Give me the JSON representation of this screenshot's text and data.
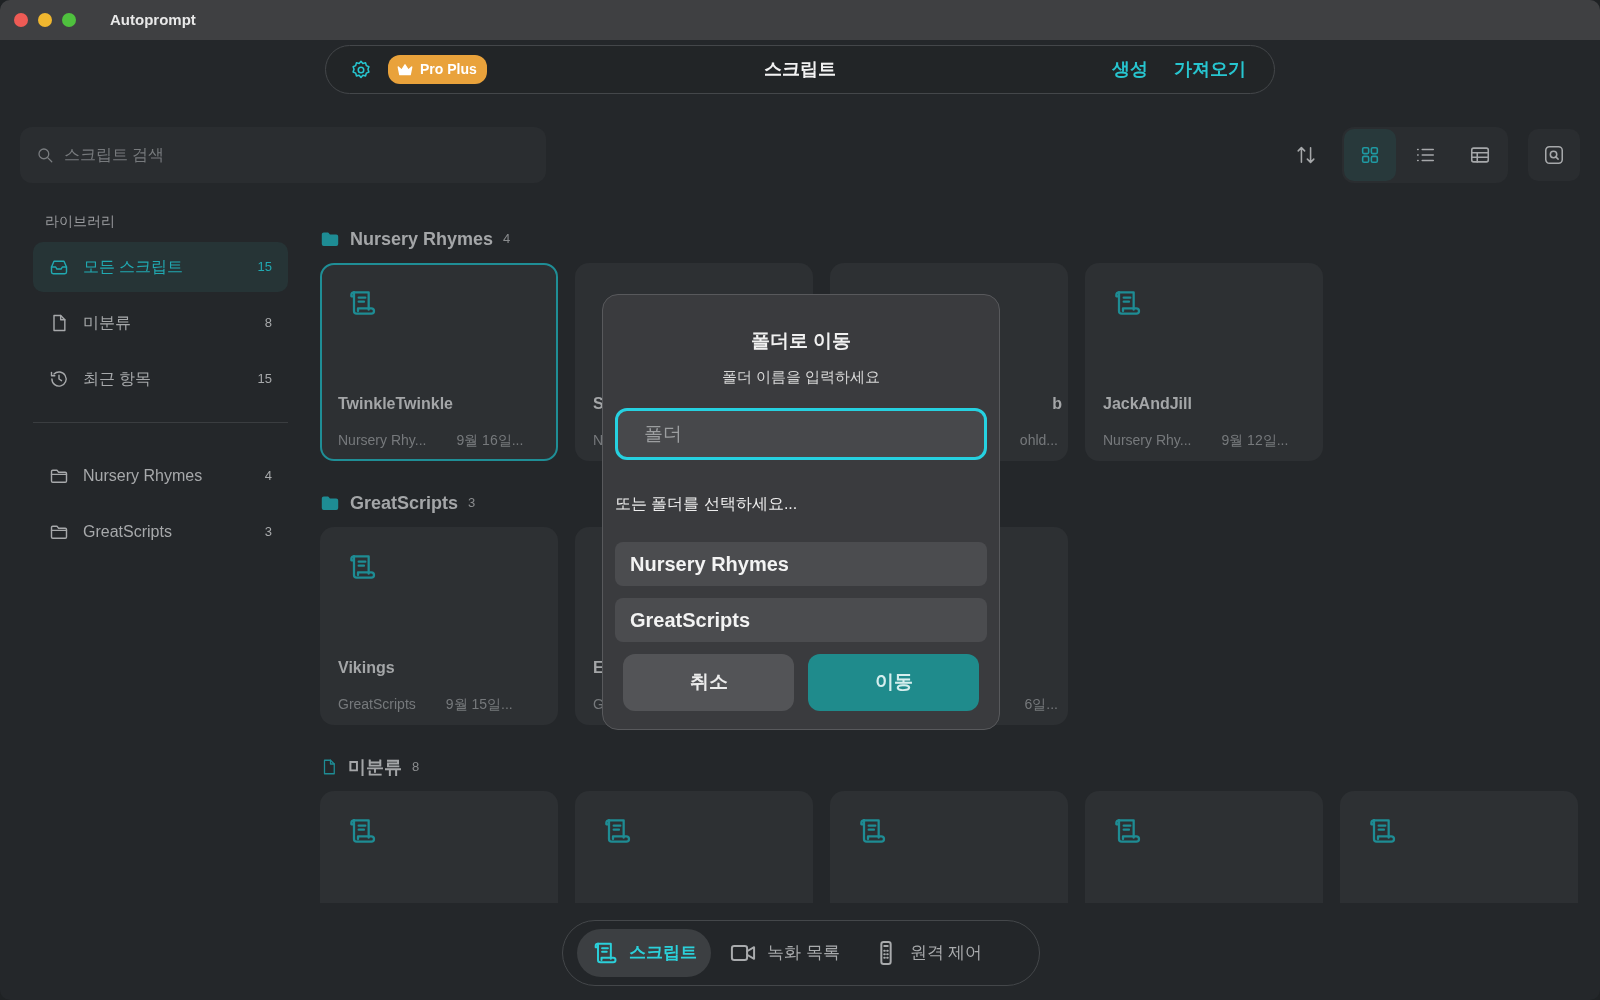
{
  "window": {
    "title": "Autoprompt"
  },
  "topbar": {
    "badge": "Pro Plus",
    "title": "스크립트",
    "actions": [
      "생성",
      "가져오기"
    ]
  },
  "search": {
    "placeholder": "스크립트 검색"
  },
  "views": [
    {
      "kind": "grid",
      "selected": true
    },
    {
      "kind": "list",
      "selected": false
    },
    {
      "kind": "table",
      "selected": false
    }
  ],
  "sidebar": {
    "heading": "라이브러리",
    "items": [
      {
        "kind": "all",
        "label": "모든 스크립트",
        "count": "15",
        "selected": true
      },
      {
        "kind": "file",
        "label": "미분류",
        "count": "8",
        "selected": false
      },
      {
        "kind": "recent",
        "label": "최근 항목",
        "count": "15",
        "selected": false
      }
    ],
    "folders": [
      {
        "label": "Nursery Rhymes",
        "count": "4",
        "selected": false
      },
      {
        "label": "GreatScripts",
        "count": "3",
        "selected": false
      }
    ]
  },
  "sections": [
    {
      "kind": "folder",
      "title": "Nursery Rhymes",
      "count": "4",
      "cards": [
        {
          "kind": "full",
          "title": "TwinkleTwinkle",
          "folder": "Nursery Rhy...",
          "date": "9월 16일...",
          "selected": true
        },
        {
          "kind": "start",
          "title": "S",
          "folder": "N",
          "selected": false
        },
        {
          "kind": "end",
          "title": "b",
          "folder": "ohld...",
          "selected": false
        },
        {
          "kind": "full",
          "title": "JackAndJill",
          "folder": "Nursery Rhy...",
          "date": "9월 12일...",
          "selected": false
        }
      ]
    },
    {
      "kind": "folder",
      "title": "GreatScripts",
      "count": "3",
      "cards": [
        {
          "kind": "full",
          "title": "Vikings",
          "folder": "GreatScripts",
          "date": "9월 15일...",
          "selected": false
        },
        {
          "kind": "start",
          "title": "E",
          "folder": "G",
          "selected": false
        },
        {
          "kind": "end",
          "date": "6일...",
          "selected": false
        }
      ]
    },
    {
      "kind": "file",
      "title": "미분류",
      "count": "8",
      "cards": [
        {
          "kind": "top",
          "selected": false
        },
        {
          "kind": "top",
          "selected": false
        },
        {
          "kind": "top",
          "selected": false
        },
        {
          "kind": "top",
          "selected": false
        },
        {
          "kind": "top",
          "selected": false
        }
      ]
    }
  ],
  "dialog": {
    "title": "폴더로 이동",
    "subtitle": "폴더 이름을 입력하세요",
    "placeholder": "폴더",
    "or_label": "또는 폴더를 선택하세요...",
    "folders": [
      "Nursery Rhymes",
      "GreatScripts"
    ],
    "buttons": [
      {
        "kind": "cancel",
        "label": "취소"
      },
      {
        "kind": "primary",
        "label": "이동"
      }
    ]
  },
  "bottom_nav": [
    {
      "kind": "script",
      "label": "스크립트",
      "selected": true
    },
    {
      "kind": "video",
      "label": "녹화 목록",
      "selected": false
    },
    {
      "kind": "remote",
      "label": "원격 제어",
      "selected": false
    }
  ]
}
